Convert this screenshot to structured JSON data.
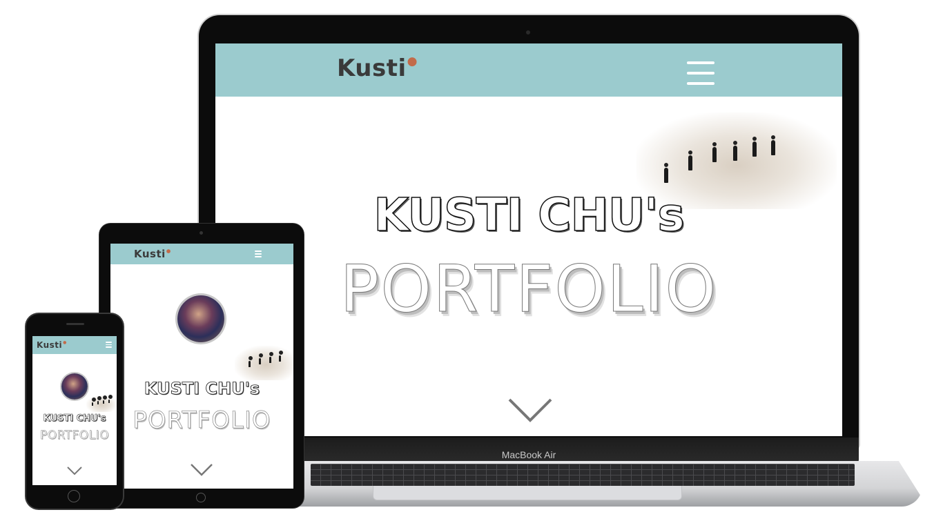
{
  "site": {
    "logo": "Kusti",
    "hero_title": "KUSTI CHU's",
    "hero_subtitle": "PORTFOLIO"
  },
  "icons": {
    "menu": "hamburger-menu-icon",
    "scroll": "chevron-down-icon",
    "logo_mark": "paw-icon"
  },
  "device": {
    "laptop_label": "MacBook Air"
  },
  "colors": {
    "header": "#9bcbce",
    "logo_text": "#3a3a3a",
    "paw": "#c26b4a",
    "device_frame": "#0c0c0c"
  }
}
